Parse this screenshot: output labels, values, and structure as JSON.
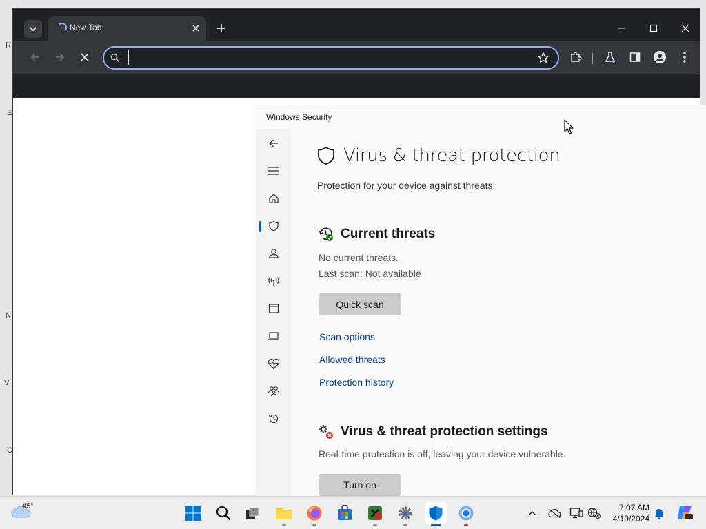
{
  "desktop": {
    "glyphs": [
      "R",
      "E",
      "N",
      "V",
      "C"
    ]
  },
  "browser": {
    "tab_title": "New Tab",
    "omnibox_value": "",
    "colors": {
      "chrome_bg": "#202124",
      "toolbar_bg": "#35363a",
      "focus_ring": "#8ab4f8"
    }
  },
  "security": {
    "window_title": "Windows Security",
    "page_title": "Virus & threat protection",
    "page_subtitle": "Protection for your device against threats.",
    "current_threats": {
      "title": "Current threats",
      "status": "No current threats.",
      "last_scan": "Last scan: Not available",
      "quick_scan_label": "Quick scan",
      "links": [
        "Scan options",
        "Allowed threats",
        "Protection history"
      ]
    },
    "settings": {
      "title": "Virus & threat protection settings",
      "status": "Real-time protection is off, leaving your device vulnerable.",
      "turn_on_label": "Turn on"
    },
    "nav_icons": [
      "back-arrow-icon",
      "hamburger-menu-icon",
      "home-icon",
      "shield-icon",
      "account-icon",
      "wifi-antenna-icon",
      "app-browser-icon",
      "laptop-icon",
      "heart-pulse-icon",
      "family-icon",
      "history-icon"
    ],
    "colors": {
      "link": "#003e92",
      "accent": "#005fb8"
    }
  },
  "taskbar": {
    "weather_temp": "45°",
    "time": "7:07 AM",
    "date": "4/19/2024",
    "apps": [
      "start-icon",
      "search-icon",
      "task-view-icon",
      "file-explorer-icon",
      "firefox-icon",
      "store-icon",
      "xbox-icon",
      "settings-icon",
      "windows-security-icon",
      "chrome-icon"
    ]
  }
}
